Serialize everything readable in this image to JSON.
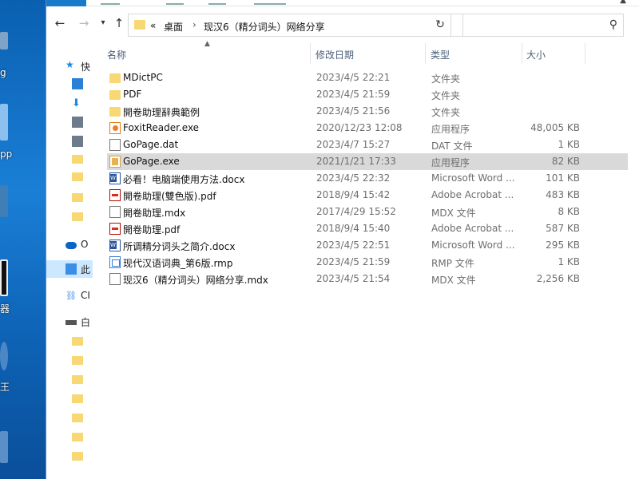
{
  "desktop": {
    "fragments": [
      "g",
      "pp",
      "器",
      "王"
    ]
  },
  "address": {
    "overflow": "«",
    "crumbs": [
      "桌面",
      "现汉6（精分词头）网络分享"
    ],
    "search_placeholder": ""
  },
  "navpane": {
    "items": [
      {
        "label": "快",
        "icon": "star-icon",
        "color": "#1e88e5"
      },
      {
        "label": "",
        "icon": "desktop-icon",
        "color": "#2b7fd6"
      },
      {
        "label": "",
        "icon": "download-icon",
        "color": "#1e88e5"
      },
      {
        "label": "",
        "icon": "document-icon",
        "color": "#6d7b8a"
      },
      {
        "label": "",
        "icon": "picture-icon",
        "color": "#6d7b8a"
      },
      {
        "label": "",
        "icon": "folder-icon",
        "color": "#f8d775"
      },
      {
        "label": "",
        "icon": "folder-icon",
        "color": "#f8d775"
      },
      {
        "label": "",
        "icon": "folder-icon",
        "color": "#f8d775"
      },
      {
        "label": "",
        "icon": "folder-icon",
        "color": "#f8d775"
      },
      {
        "label": "O",
        "icon": "onedrive-icon",
        "color": "#0a64c8"
      },
      {
        "label": "此",
        "icon": "this-pc-icon",
        "color": "#3a8ee6"
      },
      {
        "label": "CI",
        "icon": "network-icon",
        "color": "#3a8ee6"
      },
      {
        "label": "白",
        "icon": "drive-icon",
        "color": "#555555"
      },
      {
        "label": "",
        "icon": "folder-icon",
        "color": "#f8d775"
      },
      {
        "label": "",
        "icon": "folder-icon",
        "color": "#f8d775"
      },
      {
        "label": "",
        "icon": "folder-icon",
        "color": "#f8d775"
      },
      {
        "label": "",
        "icon": "folder-icon",
        "color": "#f8d775"
      },
      {
        "label": "",
        "icon": "folder-icon",
        "color": "#f8d775"
      },
      {
        "label": "",
        "icon": "folder-icon",
        "color": "#f8d775"
      },
      {
        "label": "",
        "icon": "folder-icon",
        "color": "#f8d775"
      }
    ]
  },
  "columns": {
    "name": "名称",
    "date": "修改日期",
    "type": "类型",
    "size": "大小"
  },
  "files": [
    {
      "name": "MDictPC",
      "date": "2023/4/5 22:21",
      "type": "文件夹",
      "size": "",
      "icon": "folder"
    },
    {
      "name": "PDF",
      "date": "2023/4/5 21:59",
      "type": "文件夹",
      "size": "",
      "icon": "folder"
    },
    {
      "name": "開卷助理辭典範例",
      "date": "2023/4/5 21:56",
      "type": "文件夹",
      "size": "",
      "icon": "folder"
    },
    {
      "name": "FoxitReader.exe",
      "date": "2020/12/23 12:08",
      "type": "应用程序",
      "size": "48,005 KB",
      "icon": "exe-f"
    },
    {
      "name": "GoPage.dat",
      "date": "2023/4/7 15:27",
      "type": "DAT 文件",
      "size": "1 KB",
      "icon": "doc"
    },
    {
      "name": "GoPage.exe",
      "date": "2021/1/21 17:33",
      "type": "应用程序",
      "size": "82 KB",
      "icon": "exe-g",
      "highlight": true
    },
    {
      "name": "必看！电脑端使用方法.docx",
      "date": "2023/4/5 22:32",
      "type": "Microsoft Word ...",
      "size": "101 KB",
      "icon": "word"
    },
    {
      "name": "開卷助理(雙色版).pdf",
      "date": "2018/9/4 15:42",
      "type": "Adobe Acrobat ...",
      "size": "483 KB",
      "icon": "pdf"
    },
    {
      "name": "開卷助理.mdx",
      "date": "2017/4/29 15:52",
      "type": "MDX 文件",
      "size": "8 KB",
      "icon": "doc"
    },
    {
      "name": "開卷助理.pdf",
      "date": "2018/9/4 15:40",
      "type": "Adobe Acrobat ...",
      "size": "587 KB",
      "icon": "pdf"
    },
    {
      "name": "所调精分词头之简介.docx",
      "date": "2023/4/5 22:51",
      "type": "Microsoft Word ...",
      "size": "295 KB",
      "icon": "word"
    },
    {
      "name": "现代汉语词典_第6版.rmp",
      "date": "2023/4/5 21:59",
      "type": "RMP 文件",
      "size": "1 KB",
      "icon": "rmp"
    },
    {
      "name": "现汉6（精分词头）网络分享.mdx",
      "date": "2023/4/5 21:54",
      "type": "MDX 文件",
      "size": "2,256 KB",
      "icon": "doc"
    }
  ]
}
